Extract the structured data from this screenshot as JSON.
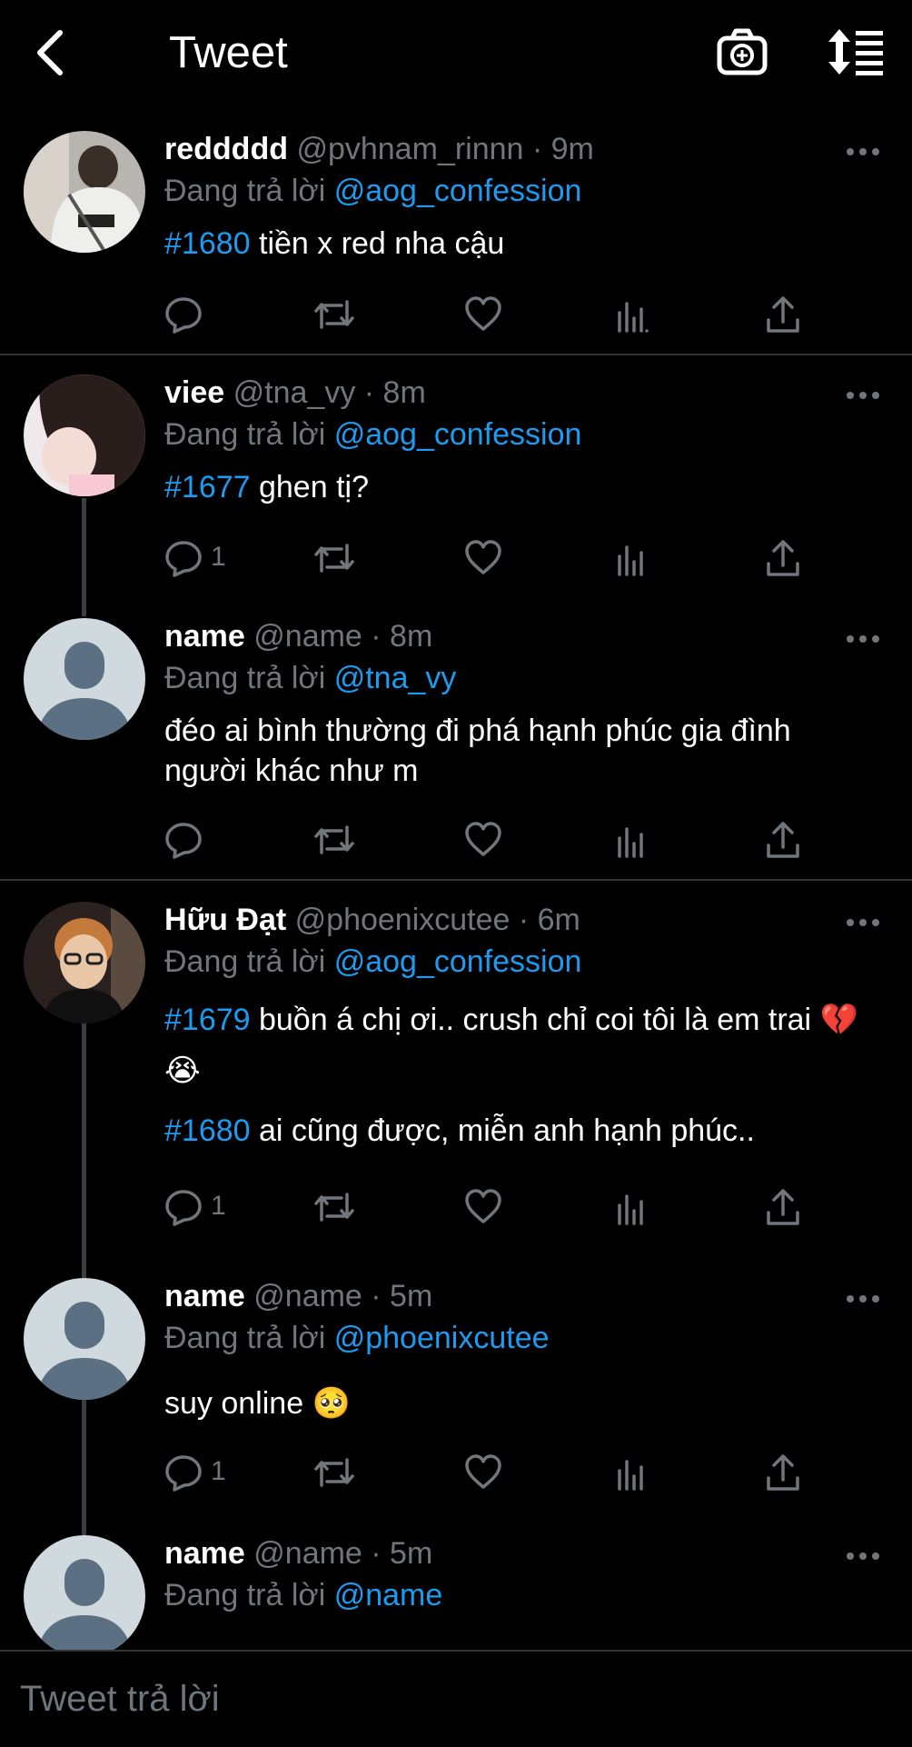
{
  "header": {
    "title": "Tweet"
  },
  "tweets": [
    {
      "name": "reddddd",
      "handle": "@pvhnam_rinnn · 9m",
      "reply_prefix": "Đang trả lời",
      "reply_to": "@aog_confession",
      "tag1": "#1680",
      "text1": " tiền x red nha cậu",
      "reply_count": ""
    },
    {
      "name": "viee",
      "handle": "@tna_vy · 8m",
      "reply_prefix": "Đang trả lời",
      "reply_to": "@aog_confession",
      "tag1": "#1677",
      "text1": " ghen tị?",
      "reply_count": "1"
    },
    {
      "name": "name",
      "handle": "@name · 8m",
      "reply_prefix": "Đang trả lời",
      "reply_to": "@tna_vy",
      "text1": "đéo ai bình thường đi phá hạnh phúc gia đình người khác như m",
      "reply_count": ""
    },
    {
      "name": "Hữu Đạt",
      "handle": "@phoenixcutee · 6m",
      "reply_prefix": "Đang trả lời",
      "reply_to": "@aog_confession",
      "tag1": "#1679",
      "text1": " buồn á chị ơi.. crush chỉ coi tôi là em trai 💔 😭",
      "tag2": "#1680",
      "text2": " ai cũng được, miễn anh hạnh phúc..",
      "reply_count": "1"
    },
    {
      "name": "name",
      "handle": "@name · 5m",
      "reply_prefix": "Đang trả lời",
      "reply_to": "@phoenixcutee",
      "text1": "suy online 🥺",
      "reply_count": "1"
    },
    {
      "name": "name",
      "handle": "@name · 5m",
      "reply_prefix": "Đang trả lời",
      "reply_to": "@name",
      "text1": "",
      "reply_count": ""
    }
  ],
  "composer": {
    "placeholder": "Tweet trả lời"
  },
  "icons": {
    "back": "chevron-left-icon",
    "camera": "camera-plus-icon",
    "sort": "sort-icon",
    "more": "more-horizontal-icon",
    "reply": "reply-icon",
    "retweet": "retweet-icon",
    "like": "heart-icon",
    "views": "views-icon",
    "share": "share-icon"
  },
  "colors": {
    "background": "#000000",
    "link": "#1d9bf0",
    "secondary": "#71767b",
    "divider": "#2f3336"
  }
}
